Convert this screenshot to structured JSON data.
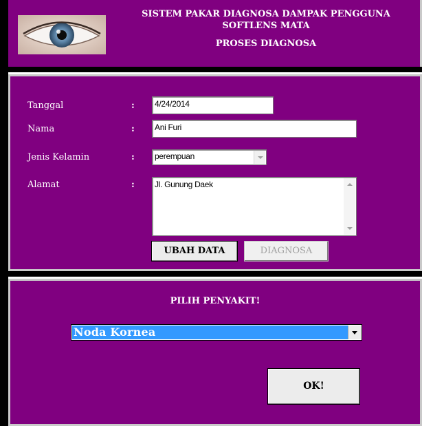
{
  "header": {
    "title_line1": "SISTEM PAKAR DIAGNOSA DAMPAK PENGGUNA",
    "title_line2": "SOFTLENS MATA",
    "subtitle": "PROSES DIAGNOSA"
  },
  "form": {
    "tanggal_label": "Tanggal",
    "tanggal_value": "4/24/2014",
    "nama_label": "Nama",
    "nama_value": "Ani Furi",
    "jk_label": "Jenis Kelamin",
    "jk_value": "perempuan",
    "alamat_label": "Alamat",
    "alamat_value": "Jl. Gunung Daek",
    "colon": ":",
    "ubah_label": "UBAH DATA",
    "diagnosa_label": "DIAGNOSA"
  },
  "disease": {
    "heading": "PILIH PENYAKIT!",
    "selected": "Noda Kornea",
    "ok_label": "OK!"
  },
  "colors": {
    "panel": "#800080",
    "selection": "#3399ff"
  },
  "icons": {
    "eye": "eye-photo"
  }
}
